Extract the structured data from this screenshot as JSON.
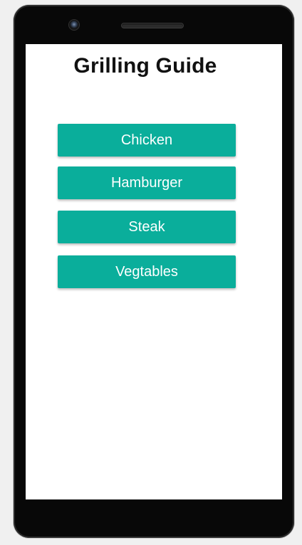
{
  "app": {
    "title": "Grilling Guide"
  },
  "menu": {
    "items": [
      {
        "label": "Chicken"
      },
      {
        "label": "Hamburger"
      },
      {
        "label": "Steak"
      },
      {
        "label": "Vegtables"
      }
    ]
  },
  "colors": {
    "button": "#0aae9b",
    "button_text": "#ffffff",
    "screen_bg": "#ffffff",
    "phone_body": "#080808",
    "page_bg": "#f0f0f0"
  },
  "icons": {
    "camera": "front-camera-icon",
    "speaker": "speaker-grille-icon"
  }
}
